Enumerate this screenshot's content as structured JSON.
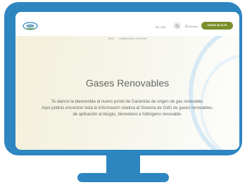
{
  "header": {
    "language": "ES | EN",
    "access_label": "Acceso",
    "signup_label": "DARSE DE ALTA"
  },
  "breadcrumb": {
    "items": [
      "Inicio",
      "Instalaciones y Garantías"
    ]
  },
  "hero": {
    "title": "Gases Renovables",
    "description_line1": "Te damos la bienvenida al nuevo portal de Garantías de origen de gas renovable.",
    "description_line2": "Aquí podrás encontrar toda la información relativa al Sistema de GdO de gases renovables,",
    "description_line3": "de aplicación al biogás, biometano e hidrógeno renovable."
  },
  "colors": {
    "monitor": "#2e86c1",
    "accent_button": "#7a8f2a"
  }
}
